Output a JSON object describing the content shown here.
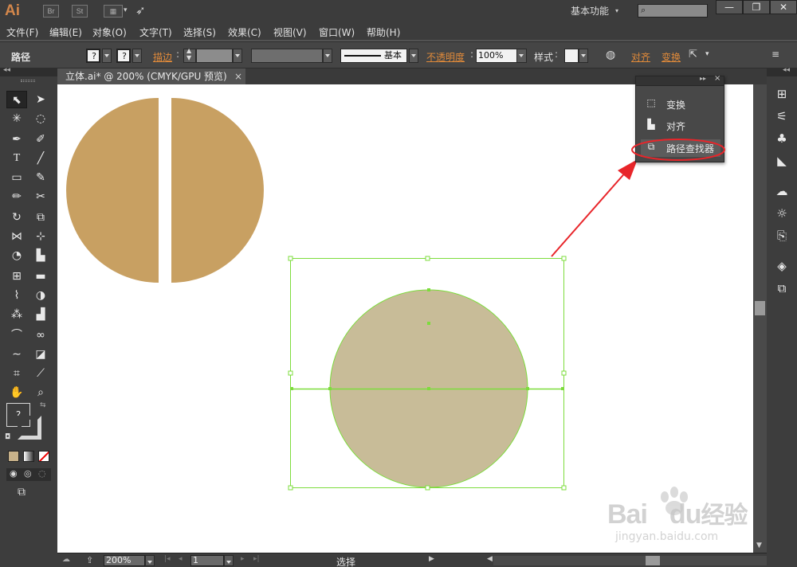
{
  "app": {
    "logo": "Ai",
    "bridge_btn": "Br",
    "stock_btn": "St",
    "workspace": "基本功能",
    "win_min": "—",
    "win_restore": "❐",
    "win_close": "✕"
  },
  "menu": [
    "文件(F)",
    "编辑(E)",
    "对象(O)",
    "文字(T)",
    "选择(S)",
    "效果(C)",
    "视图(V)",
    "窗口(W)",
    "帮助(H)"
  ],
  "control": {
    "selection_type": "路径",
    "fill_q": "?",
    "stroke_q": "?",
    "stroke_label": "描边",
    "brush_label": "基本",
    "opacity_label": "不透明度",
    "opacity_value": "100%",
    "style_label": "样式",
    "align_label": "对齐",
    "transform_label": "变换"
  },
  "document": {
    "tab_title": "立体.ai* @ 200% (CMYK/GPU 预览)",
    "close": "×"
  },
  "tools": {
    "color_q": "?"
  },
  "panel": {
    "items": [
      {
        "label": "变换",
        "icon": "transform-icon"
      },
      {
        "label": "对齐",
        "icon": "align-icon"
      },
      {
        "label": "路径查找器",
        "icon": "pathfinder-icon"
      }
    ]
  },
  "status": {
    "zoom": "200%",
    "page": "1",
    "tool_status": "选择"
  },
  "watermark": {
    "brand": "Bai",
    "brand2": "du",
    "suffix": "经验",
    "url": "jingyan.baidu.com"
  },
  "colors": {
    "shape_fill": "#c8a062",
    "selected_fill": "#c8bc98",
    "selection": "#7ddc3c",
    "arrow": "#e8252a",
    "orange_accent": "#e08a3a"
  }
}
